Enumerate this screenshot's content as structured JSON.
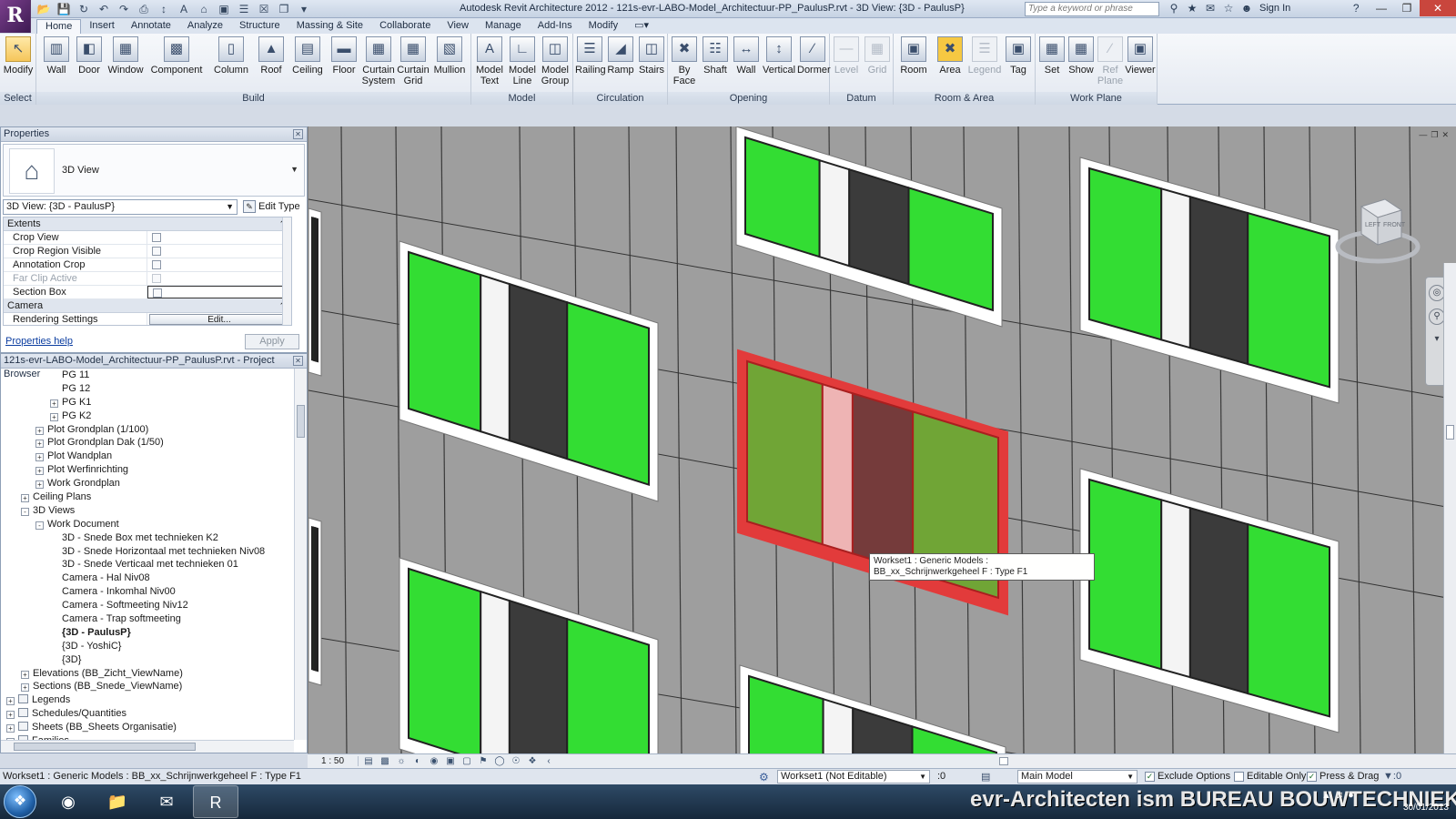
{
  "window": {
    "title": "Autodesk Revit Architecture 2012 -    121s-evr-LABO-Model_Architectuur-PP_PaulusP.rvt - 3D View: {3D - PaulusP}",
    "search_placeholder": "Type a keyword or phrase",
    "sign_in": "Sign In"
  },
  "tabs": [
    "Home",
    "Insert",
    "Annotate",
    "Analyze",
    "Structure",
    "Massing & Site",
    "Collaborate",
    "View",
    "Manage",
    "Add-Ins",
    "Modify"
  ],
  "ribbon": {
    "select": {
      "title": "Select",
      "modify": "Modify"
    },
    "build": {
      "title": "Build",
      "wall": "Wall",
      "door": "Door",
      "window": "Window",
      "component": "Component",
      "column": "Column",
      "roof": "Roof",
      "ceiling": "Ceiling",
      "floor": "Floor",
      "curtain_system": "Curtain System",
      "curtain_grid": "Curtain Grid",
      "mullion": "Mullion"
    },
    "model": {
      "title": "Model",
      "model_text": "Model Text",
      "model_line": "Model Line",
      "model_group": "Model Group"
    },
    "circulation": {
      "title": "Circulation",
      "railing": "Railing",
      "ramp": "Ramp",
      "stairs": "Stairs"
    },
    "opening": {
      "title": "Opening",
      "by_face": "By Face",
      "shaft": "Shaft",
      "wall": "Wall",
      "vertical": "Vertical",
      "dormer": "Dormer"
    },
    "datum": {
      "title": "Datum",
      "level": "Level",
      "grid": "Grid"
    },
    "room_area": {
      "title": "Room & Area",
      "room": "Room",
      "area": "Area",
      "legend": "Legend",
      "tag": "Tag"
    },
    "work_plane": {
      "title": "Work Plane",
      "set": "Set",
      "show": "Show",
      "ref_plane": "Ref Plane",
      "viewer": "Viewer"
    }
  },
  "properties": {
    "title": "Properties",
    "type_name": "3D View",
    "view_selector": "3D View: {3D - PaulusP}",
    "edit_type": "Edit Type",
    "groups": {
      "extents": "Extents",
      "camera": "Camera"
    },
    "rows": [
      {
        "label": "Crop View",
        "dim": false
      },
      {
        "label": "Crop Region Visible",
        "dim": false
      },
      {
        "label": "Annotation Crop",
        "dim": false
      },
      {
        "label": "Far Clip Active",
        "dim": true
      },
      {
        "label": "Section Box",
        "dim": false
      }
    ],
    "rendering_settings": "Rendering Settings",
    "edit_label": "Edit...",
    "help": "Properties help",
    "apply": "Apply"
  },
  "browser": {
    "title": "121s-evr-LABO-Model_Architectuur-PP_PaulusP.rvt - Project Browser",
    "nodes": [
      {
        "label": "PG 11",
        "level": 4,
        "exp": ""
      },
      {
        "label": "PG 12",
        "level": 4,
        "exp": ""
      },
      {
        "label": "PG K1",
        "level": 4,
        "exp": "+"
      },
      {
        "label": "PG K2",
        "level": 4,
        "exp": "+"
      },
      {
        "label": "Plot Grondplan (1/100)",
        "level": 3,
        "exp": "+"
      },
      {
        "label": "Plot Grondplan Dak (1/50)",
        "level": 3,
        "exp": "+"
      },
      {
        "label": "Plot Wandplan",
        "level": 3,
        "exp": "+"
      },
      {
        "label": "Plot Werfinrichting",
        "level": 3,
        "exp": "+"
      },
      {
        "label": "Work Grondplan",
        "level": 3,
        "exp": "+"
      },
      {
        "label": "Ceiling Plans",
        "level": 2,
        "exp": "+"
      },
      {
        "label": "3D Views",
        "level": 2,
        "exp": "-"
      },
      {
        "label": "Work Document",
        "level": 3,
        "exp": "-"
      },
      {
        "label": "3D - Snede Box met technieken K2",
        "level": 4,
        "exp": ""
      },
      {
        "label": "3D - Snede Horizontaal met technieken Niv08",
        "level": 4,
        "exp": ""
      },
      {
        "label": "3D - Snede Verticaal met technieken 01",
        "level": 4,
        "exp": ""
      },
      {
        "label": "Camera - Hal Niv08",
        "level": 4,
        "exp": ""
      },
      {
        "label": "Camera - Inkomhal Niv00",
        "level": 4,
        "exp": ""
      },
      {
        "label": "Camera - Softmeeting Niv12",
        "level": 4,
        "exp": ""
      },
      {
        "label": "Camera - Trap softmeeting",
        "level": 4,
        "exp": ""
      },
      {
        "label": "{3D - PaulusP}",
        "level": 4,
        "exp": "",
        "bold": true
      },
      {
        "label": "{3D - YoshiC}",
        "level": 4,
        "exp": ""
      },
      {
        "label": "{3D}",
        "level": 4,
        "exp": ""
      },
      {
        "label": "Elevations (BB_Zicht_ViewName)",
        "level": 2,
        "exp": "+"
      },
      {
        "label": "Sections (BB_Snede_ViewName)",
        "level": 2,
        "exp": "+"
      },
      {
        "label": "Legends",
        "level": 1,
        "exp": "+",
        "icon": true
      },
      {
        "label": "Schedules/Quantities",
        "level": 1,
        "exp": "+",
        "icon": true
      },
      {
        "label": "Sheets (BB_Sheets Organisatie)",
        "level": 1,
        "exp": "+",
        "icon": true
      },
      {
        "label": "Families",
        "level": 1,
        "exp": "+",
        "icon": true
      }
    ]
  },
  "viewport": {
    "tooltip": "Workset1 : Generic Models : BB_xx_Schrijnwerkgeheel F : Type F1",
    "cube_left": "LEFT",
    "cube_front": "FRONT",
    "colors": {
      "wall": "#9e9e9e",
      "glass": "#33dd33",
      "dark_panel": "#3b3b3b",
      "selection": "#e23b3b",
      "frame": "#ffffff"
    }
  },
  "view_control": {
    "scale": "1 : 50"
  },
  "status": {
    "text": "Workset1 : Generic Models : BB_xx_Schrijnwerkgeheel F : Type F1",
    "workset": "Workset1 (Not Editable)",
    "ws_count": ":0",
    "model": "Main Model",
    "exclude_options": "Exclude Options",
    "editable_only": "Editable Only",
    "press_drag": "Press & Drag",
    "filter_count": ":0"
  },
  "taskbar": {
    "watermark": "evr-Architecten ism BUREAU BOUWTECHNIEK",
    "date": "30/01/2013"
  }
}
